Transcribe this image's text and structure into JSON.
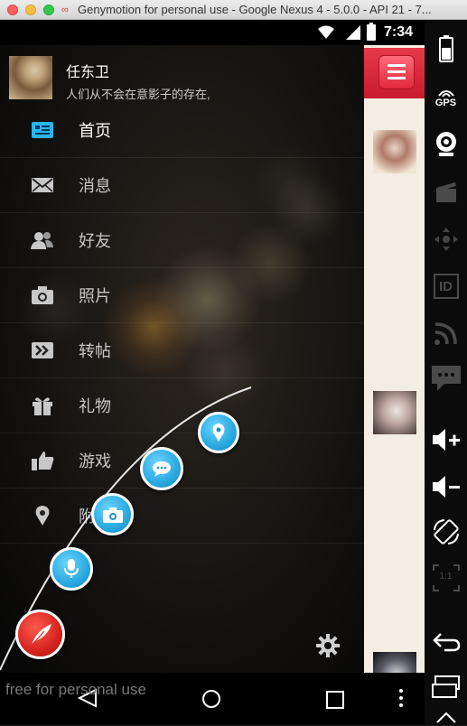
{
  "window": {
    "title": "Genymotion for personal use - Google Nexus 4 - 5.0.0 - API 21 - 7..."
  },
  "statusbar": {
    "time": "7:34",
    "icons": [
      "wifi-icon",
      "signal-icon",
      "battery-icon"
    ]
  },
  "profile": {
    "name": "任东卫",
    "signature": "人们从不会在意影子的存在,"
  },
  "menu": {
    "items": [
      {
        "label": "首页",
        "icon": "home-icon",
        "active": true
      },
      {
        "label": "消息",
        "icon": "mail-icon"
      },
      {
        "label": "好友",
        "icon": "friends-icon"
      },
      {
        "label": "照片",
        "icon": "camera-icon"
      },
      {
        "label": "转帖",
        "icon": "forward-icon"
      },
      {
        "label": "礼物",
        "icon": "gift-icon"
      },
      {
        "label": "游戏",
        "icon": "thumbs-up-icon"
      },
      {
        "label": "附",
        "icon": "location-pin-icon"
      }
    ]
  },
  "fab_menu": {
    "items": [
      "location-pin-icon",
      "chat-bubble-icon",
      "camera-icon",
      "microphone-icon"
    ],
    "main": "feather-icon"
  },
  "right_panel": {
    "menu_button": "hamburger-menu-icon",
    "thumbnails": 3
  },
  "navbar": {
    "buttons": [
      "back-icon",
      "home-circle-icon",
      "recents-square-icon",
      "overflow-dots-icon"
    ]
  },
  "watermark": "free for personal use",
  "genymotion_sidebar": {
    "gps_label": "GPS",
    "id_label": "ID",
    "ratio_label": "1:1"
  },
  "colors": {
    "accent_blue": "#29a9e0",
    "menu_red": "#d62420",
    "panel_bg": "#f3ede3"
  }
}
